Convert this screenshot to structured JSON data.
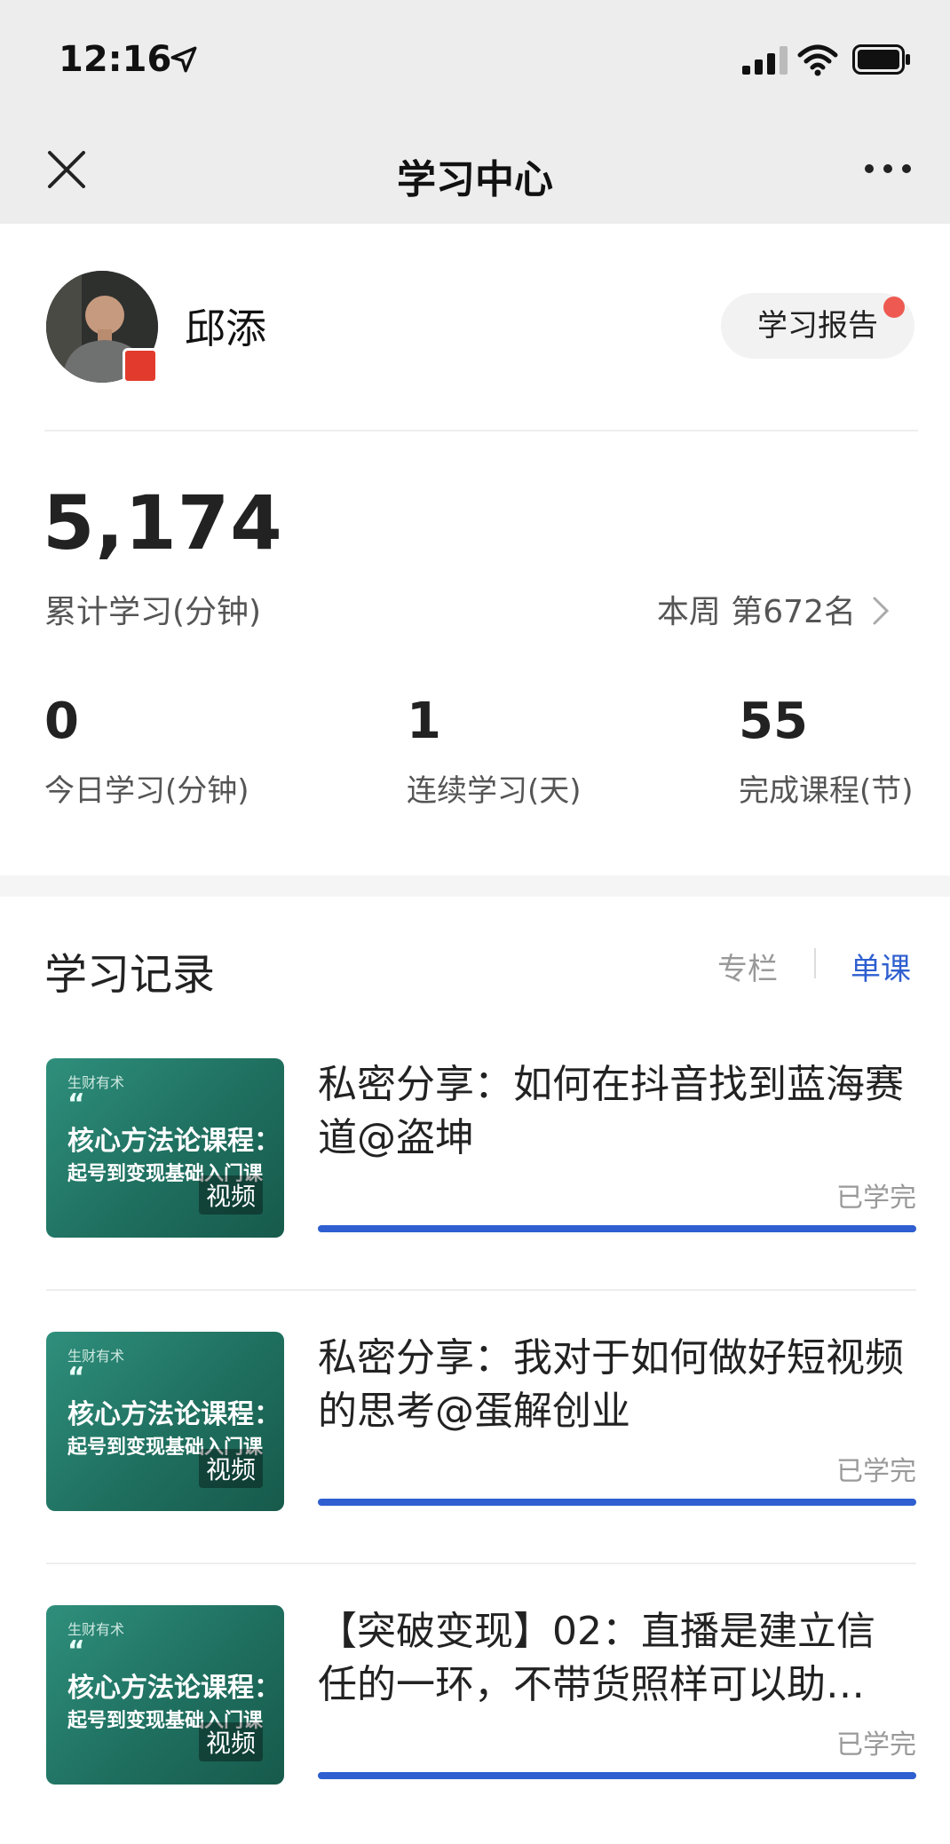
{
  "status_bar": {
    "time": "12:16"
  },
  "nav": {
    "title": "学习中心"
  },
  "profile": {
    "name": "邱添",
    "report_button": "学习报告"
  },
  "summary": {
    "total_minutes": "5,174",
    "total_label": "累计学习(分钟)",
    "rank_text": "本周 第672名"
  },
  "stats": [
    {
      "value": "0",
      "label": "今日学习(分钟)"
    },
    {
      "value": "1",
      "label": "连续学习(天)"
    },
    {
      "value": "55",
      "label": "完成课程(节)"
    }
  ],
  "records": {
    "title": "学习记录",
    "tabs": {
      "column": "专栏",
      "single": "单课",
      "active": "single"
    },
    "items": [
      {
        "title": "私密分享：如何在抖音找到蓝海赛道@盗坤",
        "status": "已学完",
        "progress": 1.0,
        "thumb": {
          "logo": "生财有术",
          "quote": "“",
          "line1": "核心方法论课程：",
          "line2": "起号到变现基础入门课",
          "tag": "视频"
        }
      },
      {
        "title": "私密分享：我对于如何做好短视频的思考@蛋解创业",
        "status": "已学完",
        "progress": 1.0,
        "thumb": {
          "logo": "生财有术",
          "quote": "“",
          "line1": "核心方法论课程：",
          "line2": "起号到变现基础入门课",
          "tag": "视频"
        }
      },
      {
        "title": "【突破变现】02：直播是建立信任的一环，不带货照样可以助…",
        "status": "已学完",
        "progress": 1.0,
        "thumb": {
          "logo": "生财有术",
          "quote": "“",
          "line1": "核心方法论课程：",
          "line2": "起号到变现基础入门课",
          "tag": "视频"
        }
      }
    ]
  },
  "colors": {
    "accent": "#2f5fd0",
    "badge_red": "#ee5a52",
    "header_bg": "#ededed",
    "thumb_green": "#1f6f5f"
  }
}
